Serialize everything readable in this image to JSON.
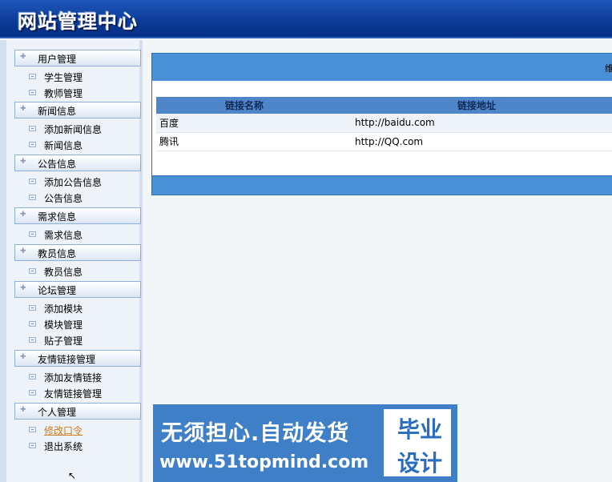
{
  "header": {
    "title": "网站管理中心"
  },
  "sidebar": {
    "groups": [
      {
        "label": "用户管理",
        "items": [
          "学生管理",
          "教师管理"
        ]
      },
      {
        "label": "新闻信息",
        "items": [
          "添加新闻信息",
          "新闻信息"
        ]
      },
      {
        "label": "公告信息",
        "items": [
          "添加公告信息",
          "公告信息"
        ]
      },
      {
        "label": "需求信息",
        "items": [
          "需求信息"
        ]
      },
      {
        "label": "教员信息",
        "items": [
          "教员信息"
        ]
      },
      {
        "label": "论坛管理",
        "items": [
          "添加模块",
          "模块管理",
          "贴子管理"
        ]
      },
      {
        "label": "友情链接管理",
        "items": [
          "添加友情链接",
          "友情链接管理"
        ]
      },
      {
        "label": "个人管理",
        "items": [
          "修改口令",
          "退出系统"
        ]
      }
    ],
    "active_item": "修改口令"
  },
  "main": {
    "header_text": "维",
    "table": {
      "columns": [
        "链接名称",
        "链接地址"
      ],
      "rows": [
        {
          "name": "百度",
          "url": "http://baidu.com"
        },
        {
          "name": "腾讯",
          "url": "http://QQ.com"
        }
      ]
    }
  },
  "ad": {
    "line1": "无须担心.自动发货",
    "line2": "www.51topmind.com",
    "side1": "毕业",
    "side2": "设计"
  },
  "colors": {
    "header_bg": "#0b3a98",
    "panel_bar": "#4a90d6",
    "active_link": "#d07a1a"
  }
}
